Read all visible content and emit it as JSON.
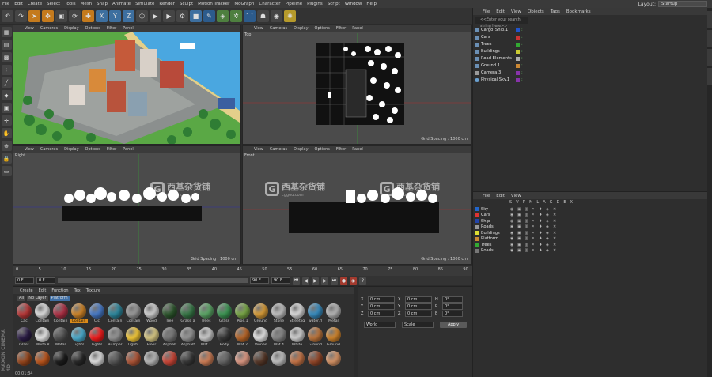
{
  "menubar": {
    "items": [
      "File",
      "Edit",
      "Create",
      "Select",
      "Tools",
      "Mesh",
      "Snap",
      "Animate",
      "Simulate",
      "Render",
      "Sculpt",
      "Motion Tracker",
      "MoGraph",
      "Character",
      "Pipeline",
      "Plugins",
      "Script",
      "Window",
      "Help"
    ],
    "layout_label": "Layout:",
    "layout_value": "Startup"
  },
  "toolbar": {
    "buttons": [
      {
        "name": "undo-icon",
        "glyph": "↶",
        "c": ""
      },
      {
        "name": "redo-icon",
        "glyph": "↷",
        "c": ""
      },
      {
        "name": "select-icon",
        "glyph": "➤",
        "c": "o"
      },
      {
        "name": "move-icon",
        "glyph": "✥",
        "c": "o"
      },
      {
        "name": "scale-icon",
        "glyph": "▣",
        "c": ""
      },
      {
        "name": "rotate-icon",
        "glyph": "⟳",
        "c": ""
      },
      {
        "name": "recent-icon",
        "glyph": "✚",
        "c": "o"
      },
      {
        "name": "x-axis-icon",
        "glyph": "X",
        "c": "b"
      },
      {
        "name": "y-axis-icon",
        "glyph": "Y",
        "c": "b"
      },
      {
        "name": "z-axis-icon",
        "glyph": "Z",
        "c": "b"
      },
      {
        "name": "coord-icon",
        "glyph": "⬡",
        "c": ""
      },
      {
        "name": "render-view-icon",
        "glyph": "▶",
        "c": ""
      },
      {
        "name": "render-icon",
        "glyph": "▶",
        "c": ""
      },
      {
        "name": "render-settings-icon",
        "glyph": "⚙",
        "c": ""
      },
      {
        "name": "cube-icon",
        "glyph": "■",
        "c": "b"
      },
      {
        "name": "pen-icon",
        "glyph": "✎",
        "c": "bl"
      },
      {
        "name": "subdivision-icon",
        "glyph": "◈",
        "c": "g"
      },
      {
        "name": "array-icon",
        "glyph": "✲",
        "c": "g"
      },
      {
        "name": "deformer-icon",
        "glyph": "⌒",
        "c": "bl"
      },
      {
        "name": "scene-icon",
        "glyph": "☗",
        "c": ""
      },
      {
        "name": "camera-icon",
        "glyph": "◉",
        "c": ""
      },
      {
        "name": "light-icon",
        "glyph": "✺",
        "c": "y"
      }
    ]
  },
  "leftbar": {
    "buttons": [
      "cube-mode-icon",
      "texture-icon",
      "checker-icon",
      "points-icon",
      "edges-icon",
      "polygons-icon",
      "uv-icon",
      "axis-icon",
      "tweak-icon",
      "snap-icon",
      "lock-icon",
      "workplane-icon"
    ]
  },
  "viewports": {
    "menu": [
      "View",
      "Cameras",
      "Display",
      "Options",
      "Filter",
      "Panel"
    ],
    "top_name": "Top",
    "right_name": "Right",
    "front_name": "Front",
    "grid_spacing": "Grid Spacing : 1000 cm"
  },
  "timeline": {
    "ticks": [
      "0",
      "5",
      "10",
      "15",
      "20",
      "25",
      "30",
      "35",
      "40",
      "45",
      "50",
      "55",
      "60",
      "65",
      "70",
      "75",
      "80",
      "85",
      "90"
    ],
    "frame": "0 F",
    "start": "0 F",
    "end": "90 F",
    "max": "90 F",
    "current": "0 F"
  },
  "materials": {
    "menu": [
      "Create",
      "Edit",
      "Function",
      "Tex",
      "Texture"
    ],
    "filters": [
      "All",
      "No Layer",
      "Platform"
    ],
    "items": [
      {
        "n": "Cac",
        "c": "#c23b3b"
      },
      {
        "n": "Contain",
        "c": "#e8e8e8"
      },
      {
        "n": "Contain",
        "c": "#b8344a"
      },
      {
        "n": "Contain",
        "c": "#d88a2a",
        "hl": true
      },
      {
        "n": "Cic",
        "c": "#4a7fd0"
      },
      {
        "n": "Contain",
        "c": "#2f8fa6"
      },
      {
        "n": "Contain",
        "c": "#a0a0a0"
      },
      {
        "n": "Wood",
        "c": "#d9d9d9"
      },
      {
        "n": "Tree",
        "c": "#2f5a2f"
      },
      {
        "n": "Grass_a",
        "c": "#3a7d4a"
      },
      {
        "n": "Trees",
        "c": "#5fae6a"
      },
      {
        "n": "Grass",
        "c": "#3f9d57"
      },
      {
        "n": "Pipe.1",
        "c": "#7fb04a"
      },
      {
        "n": "Ground",
        "c": "#e2a33a"
      },
      {
        "n": "Stone",
        "c": "#c9c9c9"
      },
      {
        "n": "Streetlig",
        "c": "#e6e6e6"
      },
      {
        "n": "water.fl",
        "c": "#3a93c9"
      },
      {
        "n": "Metal",
        "c": "#bdbdbd"
      },
      {
        "n": "Glass",
        "c": "#2e1f4a"
      },
      {
        "n": "White.P",
        "c": "#f2f2f2"
      },
      {
        "n": "Metal",
        "c": "#555555"
      },
      {
        "n": "Lights",
        "c": "#4fb5d8"
      },
      {
        "n": "Lights",
        "c": "#ff1d1d"
      },
      {
        "n": "Bumper",
        "c": "#9a9a9a"
      },
      {
        "n": "Lights",
        "c": "#ffd23a"
      },
      {
        "n": "Floor",
        "c": "#e3d28a"
      },
      {
        "n": "Asphalt",
        "c": "#7d7d7d"
      },
      {
        "n": "Asphalt",
        "c": "#9c9c9c"
      },
      {
        "n": "Mat.1",
        "c": "#d6d6d6"
      },
      {
        "n": "Body",
        "c": "#3a3a3a"
      },
      {
        "n": "Mat.2",
        "c": "#c06a2a"
      },
      {
        "n": "Vinnes",
        "c": "#efefef"
      },
      {
        "n": "Mat.4",
        "c": "#8c8c8c"
      },
      {
        "n": "White",
        "c": "#dcdcdc"
      },
      {
        "n": "Ground",
        "c": "#c57a3e"
      },
      {
        "n": "Ground",
        "c": "#d98a2e"
      },
      {
        "n": "",
        "c": "#a04a1e"
      },
      {
        "n": "",
        "c": "#c65a1e"
      },
      {
        "n": "",
        "c": "#1e1e1e"
      },
      {
        "n": "",
        "c": "#2a2a2a"
      },
      {
        "n": "",
        "c": "#eaeaea"
      },
      {
        "n": "",
        "c": "#5a5a5a"
      },
      {
        "n": "",
        "c": "#b85a3a"
      },
      {
        "n": "",
        "c": "#c0c0c0"
      },
      {
        "n": "",
        "c": "#d64a3a"
      },
      {
        "n": "",
        "c": "#3a3a3a"
      },
      {
        "n": "",
        "c": "#d9845a"
      },
      {
        "n": "",
        "c": "#6a6a6a"
      },
      {
        "n": "",
        "c": "#e8a08a"
      },
      {
        "n": "",
        "c": "#5a3a2a"
      },
      {
        "n": "",
        "c": "#c9c9c9"
      },
      {
        "n": "",
        "c": "#d07a4a"
      },
      {
        "n": "",
        "c": "#9a4a2a"
      },
      {
        "n": "",
        "c": "#e09a6a"
      }
    ]
  },
  "coords": {
    "rows": [
      {
        "a": "X",
        "v1": "0 cm",
        "b": "X",
        "v2": "0 cm",
        "c": "H",
        "v3": "0°"
      },
      {
        "a": "Y",
        "v1": "0 cm",
        "b": "Y",
        "v2": "0 cm",
        "c": "P",
        "v3": "0°"
      },
      {
        "a": "Z",
        "v1": "0 cm",
        "b": "Z",
        "v2": "0 cm",
        "c": "B",
        "v3": "0°"
      }
    ],
    "mode1": "World",
    "mode2": "Scale",
    "apply": "Apply"
  },
  "objects": {
    "menu": [
      "File",
      "Edit",
      "View",
      "Objects",
      "Tags",
      "Bookmarks"
    ],
    "search_placeholder": "<<Enter your search string here>>",
    "items": [
      {
        "n": "Cargo_Ship.1",
        "t": "#2255cc",
        "k": ""
      },
      {
        "n": "Cars",
        "t": "#cc3333",
        "k": ""
      },
      {
        "n": "Trees",
        "t": "#33aa33",
        "k": ""
      },
      {
        "n": "Buildings",
        "t": "#cccc33",
        "k": ""
      },
      {
        "n": "Road Elements",
        "t": "#b0b0b0",
        "k": ""
      },
      {
        "n": "Ground.1",
        "t": "#cc8833",
        "k": ""
      },
      {
        "n": "Camera.3",
        "t": "#8833aa",
        "k": "cam"
      },
      {
        "n": "Physical Sky.1",
        "t": "#8833aa",
        "k": "sky"
      }
    ]
  },
  "layers": {
    "menu": [
      "File",
      "Edit",
      "View"
    ],
    "cols": [
      "S",
      "V",
      "R",
      "M",
      "L",
      "A",
      "G",
      "D",
      "E",
      "X"
    ],
    "items": [
      {
        "n": "Sky",
        "c": "#2266cc"
      },
      {
        "n": "Cars",
        "c": "#dd3333"
      },
      {
        "n": "Ship",
        "c": "#2244aa"
      },
      {
        "n": "Roads",
        "c": "#999999"
      },
      {
        "n": "Buildings",
        "c": "#dddd33"
      },
      {
        "n": "Platform",
        "c": "#cc8833"
      },
      {
        "n": "Trees",
        "c": "#33aa33"
      },
      {
        "n": "Roads",
        "c": "#777777"
      }
    ]
  },
  "watermark": {
    "cn": "西基杂货铺",
    "en": "cggou.com"
  },
  "status": {
    "time": "00:01:34"
  },
  "brand": "MAXON CINEMA 4D"
}
